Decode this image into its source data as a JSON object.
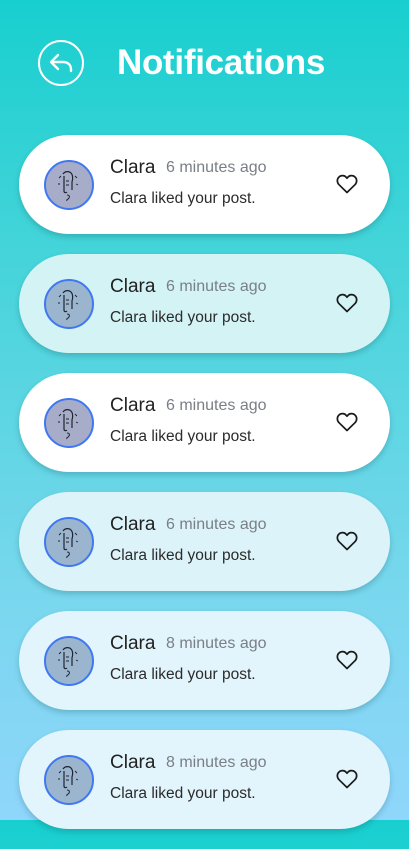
{
  "header": {
    "title": "Notifications",
    "back_icon": "undo-arrow-icon"
  },
  "notifications": [
    {
      "name": "Clara",
      "time": "6 minutes ago",
      "message": "Clara liked your post.",
      "style": "read",
      "icon": "heart-outline-icon"
    },
    {
      "name": "Clara",
      "time": "6 minutes ago",
      "message": "Clara liked your post.",
      "style": "unread-1",
      "icon": "heart-outline-icon"
    },
    {
      "name": "Clara",
      "time": "6 minutes ago",
      "message": "Clara liked your post.",
      "style": "read",
      "icon": "heart-outline-icon"
    },
    {
      "name": "Clara",
      "time": "6 minutes ago",
      "message": "Clara liked your post.",
      "style": "unread-2",
      "icon": "heart-outline-icon"
    },
    {
      "name": "Clara",
      "time": "8 minutes ago",
      "message": "Clara liked your post.",
      "style": "unread-3",
      "icon": "heart-outline-icon"
    },
    {
      "name": "Clara",
      "time": "8 minutes ago",
      "message": "Clara liked your post.",
      "style": "unread-3",
      "icon": "heart-outline-icon"
    }
  ],
  "colors": {
    "gradient_top": "#18cfcf",
    "gradient_bottom": "#8fd6fb",
    "avatar_border": "#3f78f1",
    "read_card": "#ffffff",
    "unread_card": "#d4f3f5"
  }
}
